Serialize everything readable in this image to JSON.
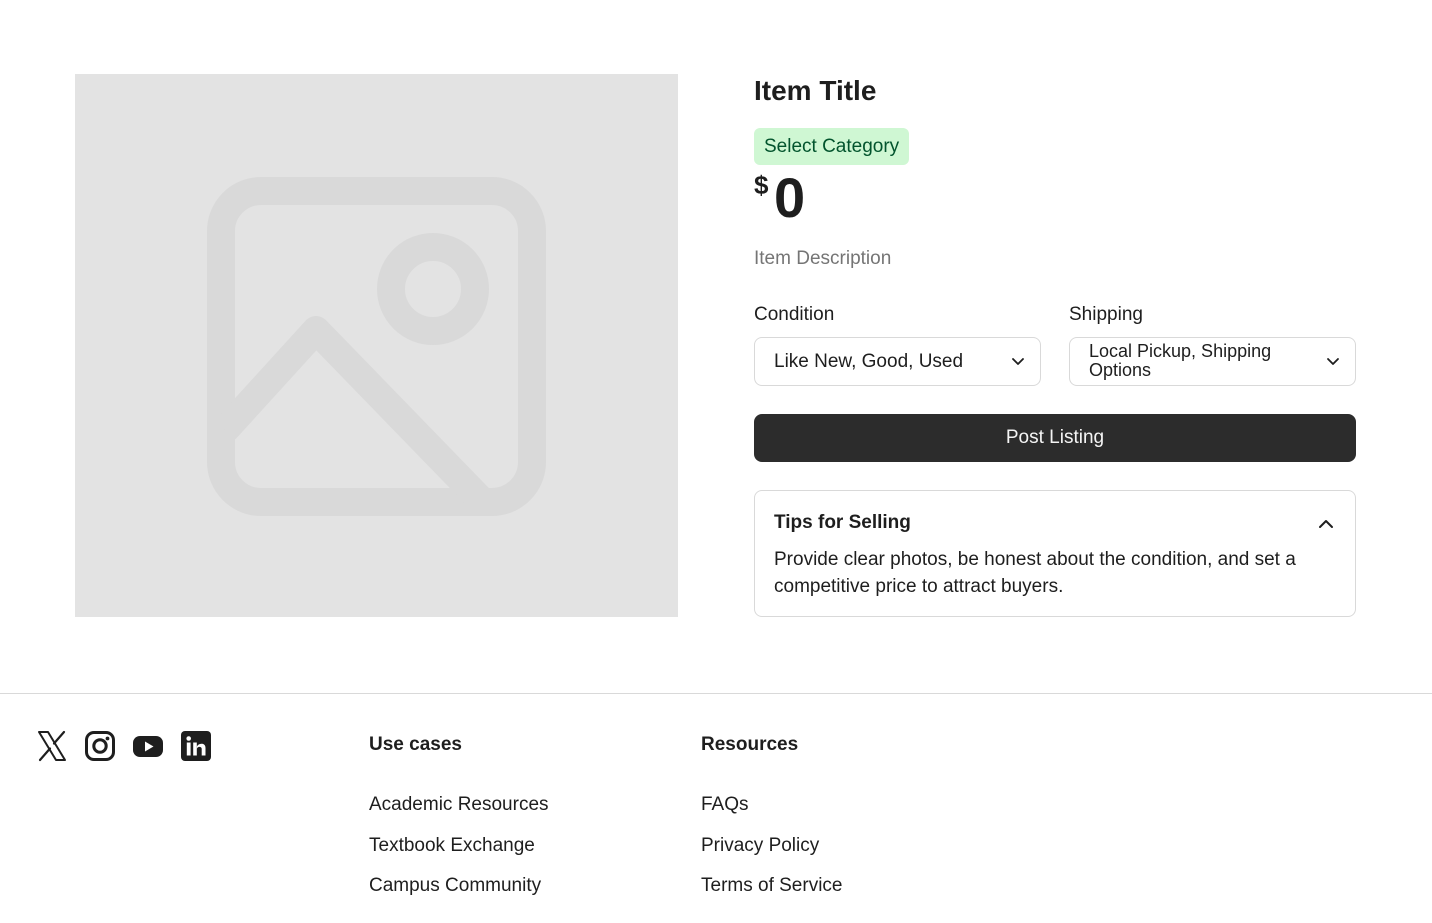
{
  "listing": {
    "title": "Item Title",
    "category_tag": "Select Category",
    "price_currency": "$",
    "price_value": "0",
    "description_placeholder": "Item Description",
    "image_icon": "image-placeholder-icon"
  },
  "form": {
    "condition": {
      "label": "Condition",
      "value": "Like New, Good, Used"
    },
    "shipping": {
      "label": "Shipping",
      "value": "Local Pickup, Shipping Options"
    },
    "submit_label": "Post Listing"
  },
  "tips": {
    "title": "Tips for Selling",
    "body": "Provide clear photos, be honest about the condition, and set a competitive price to attract buyers."
  },
  "footer": {
    "social_icons": [
      "x-icon",
      "instagram-icon",
      "youtube-icon",
      "linkedin-icon"
    ],
    "columns": [
      {
        "title": "Use cases",
        "links": [
          "Academic Resources",
          "Textbook Exchange",
          "Campus Community"
        ]
      },
      {
        "title": "Resources",
        "links": [
          "FAQs",
          "Privacy Policy",
          "Terms of Service"
        ]
      }
    ]
  },
  "colors": {
    "tag_background": "#cff7d3",
    "tag_text": "#02542d",
    "button_background": "#2c2c2c",
    "placeholder_background": "#e3e3e3"
  }
}
